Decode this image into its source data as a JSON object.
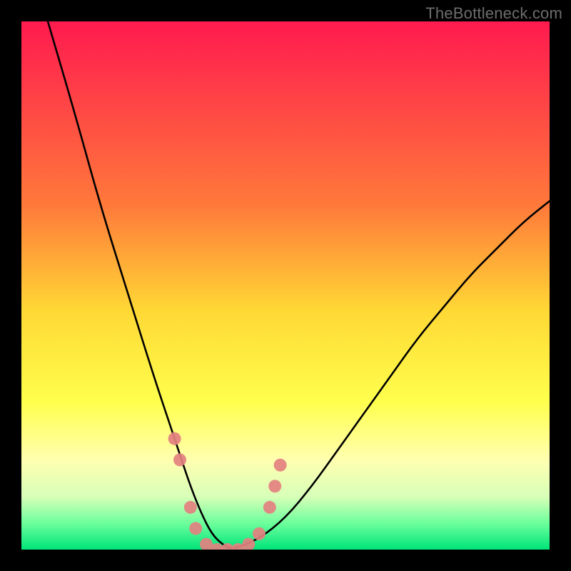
{
  "watermark": "TheBottleneck.com",
  "colors": {
    "frame": "#000000",
    "curve": "#000000",
    "marker": "#e48080",
    "watermark": "#6d6d6d"
  },
  "chart_data": {
    "type": "line",
    "title": "",
    "xlabel": "",
    "ylabel": "",
    "xlim": [
      0,
      100
    ],
    "ylim": [
      0,
      100
    ],
    "grid": false,
    "legend": false,
    "gradient_stops": [
      {
        "pos": 0.0,
        "color": "#ff1a4f"
      },
      {
        "pos": 0.35,
        "color": "#ff7a3a"
      },
      {
        "pos": 0.55,
        "color": "#ffd935"
      },
      {
        "pos": 0.72,
        "color": "#ffff4d"
      },
      {
        "pos": 0.83,
        "color": "#ffffb0"
      },
      {
        "pos": 0.9,
        "color": "#d8ffb8"
      },
      {
        "pos": 0.95,
        "color": "#6cff9c"
      },
      {
        "pos": 1.0,
        "color": "#00e47a"
      }
    ],
    "series": [
      {
        "name": "bottleneck-curve",
        "x": [
          5,
          10,
          15,
          20,
          25,
          28,
          30,
          32,
          34,
          36,
          38,
          40,
          45,
          50,
          55,
          60,
          65,
          70,
          75,
          80,
          85,
          90,
          95,
          100
        ],
        "y": [
          100,
          83,
          65,
          49,
          33,
          24,
          18,
          12,
          7,
          3,
          1,
          0,
          2,
          6,
          12,
          19,
          26,
          33,
          40,
          46,
          52,
          57,
          62,
          66
        ]
      }
    ],
    "markers": {
      "name": "highlighted-points",
      "points": [
        {
          "x": 29,
          "y": 21
        },
        {
          "x": 30,
          "y": 17
        },
        {
          "x": 32,
          "y": 8
        },
        {
          "x": 33,
          "y": 4
        },
        {
          "x": 35,
          "y": 1
        },
        {
          "x": 37,
          "y": 0
        },
        {
          "x": 39,
          "y": 0
        },
        {
          "x": 41,
          "y": 0
        },
        {
          "x": 43,
          "y": 1
        },
        {
          "x": 45,
          "y": 3
        },
        {
          "x": 47,
          "y": 8
        },
        {
          "x": 48,
          "y": 12
        },
        {
          "x": 49,
          "y": 16
        }
      ]
    }
  }
}
